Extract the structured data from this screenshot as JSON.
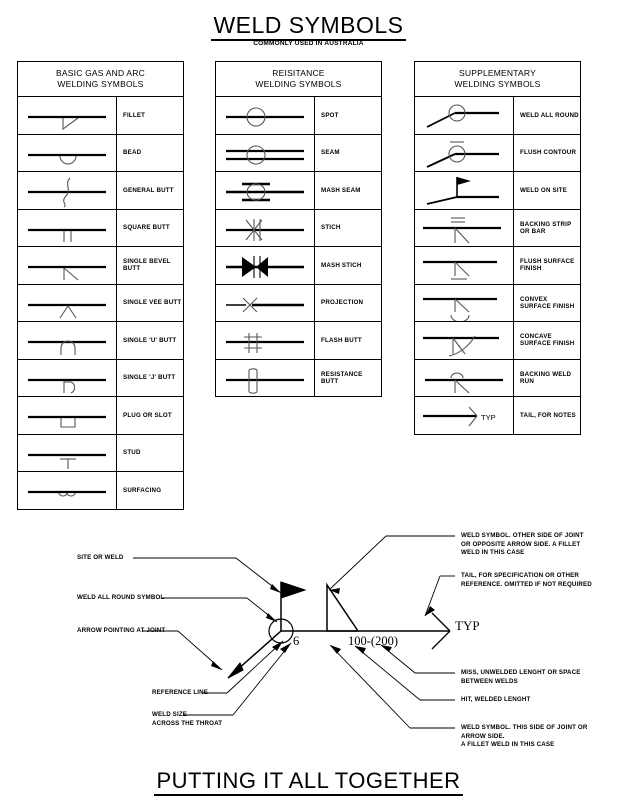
{
  "header": {
    "title": "WELD SYMBOLS",
    "subtitle": "COMMONLY USED IN AUSTRALIA"
  },
  "footer": {
    "title": "PUTTING IT ALL TOGETHER"
  },
  "tables": [
    {
      "id": "basic",
      "header_line1": "BASIC GAS AND ARC",
      "header_line2": "WELDING SYMBOLS",
      "rows": [
        {
          "symbol": "fillet-symbol",
          "label": "FILLET"
        },
        {
          "symbol": "bead-symbol",
          "label": "BEAD"
        },
        {
          "symbol": "general-butt-symbol",
          "label": "GENERAL BUTT"
        },
        {
          "symbol": "square-butt-symbol",
          "label": "SQUARE BUTT"
        },
        {
          "symbol": "single-bevel-butt-symbol",
          "label": "SINGLE BEVEL BUTT"
        },
        {
          "symbol": "single-vee-butt-symbol",
          "label": "SINGLE VEE BUTT"
        },
        {
          "symbol": "single-u-butt-symbol",
          "label": "SINGLE 'U' BUTT"
        },
        {
          "symbol": "single-j-butt-symbol",
          "label": "SINGLE 'J' BUTT"
        },
        {
          "symbol": "plug-or-slot-symbol",
          "label": "PLUG OR SLOT"
        },
        {
          "symbol": "stud-symbol",
          "label": "STUD"
        },
        {
          "symbol": "surfacing-symbol",
          "label": "SURFACING"
        }
      ]
    },
    {
      "id": "resistance",
      "header_line1": "REISITANCE",
      "header_line2": "WELDING SYMBOLS",
      "rows": [
        {
          "symbol": "spot-symbol",
          "label": "SPOT"
        },
        {
          "symbol": "seam-symbol",
          "label": "SEAM"
        },
        {
          "symbol": "mash-seam-symbol",
          "label": "MASH SEAM"
        },
        {
          "symbol": "stich-symbol",
          "label": "STICH"
        },
        {
          "symbol": "mash-stich-symbol",
          "label": "MASH STICH"
        },
        {
          "symbol": "projection-symbol",
          "label": "PROJECTION"
        },
        {
          "symbol": "flash-butt-symbol",
          "label": "FLASH BUTT"
        },
        {
          "symbol": "resistance-butt-symbol",
          "label": "RESISTANCE BUTT"
        }
      ]
    },
    {
      "id": "supplementary",
      "header_line1": "SUPPLEMENTARY",
      "header_line2": "WELDING SYMBOLS",
      "rows": [
        {
          "symbol": "weld-all-round-symbol",
          "label": "WELD ALL ROUND"
        },
        {
          "symbol": "flush-contour-symbol",
          "label": "FLUSH CONTOUR"
        },
        {
          "symbol": "weld-on-site-symbol",
          "label": "WELD ON SITE"
        },
        {
          "symbol": "backing-strip-symbol",
          "label": "BACKING STRIP OR BAR"
        },
        {
          "symbol": "flush-surface-finish-symbol",
          "label": "FLUSH SURFACE FINISH"
        },
        {
          "symbol": "convex-surface-finish-symbol",
          "label": "CONVEX SURFACE FINISH"
        },
        {
          "symbol": "concave-surface-finish-symbol",
          "label": "CONCAVE SURFACE FINISH"
        },
        {
          "symbol": "backing-weld-run-symbol",
          "label": "BACKING WELD RUN"
        },
        {
          "symbol": "tail-for-notes-symbol",
          "label": "TAIL, FOR NOTES",
          "symbol_text": "TYP"
        }
      ]
    }
  ],
  "diagram": {
    "weld_size": "6",
    "weld_length": "100-(200)",
    "tail_text": "TYP",
    "labels_left": [
      {
        "name": "site-or-weld-label",
        "text": "SITE OR WELD"
      },
      {
        "name": "weld-all-round-label",
        "text": "WELD ALL ROUND SYMBOL"
      },
      {
        "name": "arrow-pointing-at-joint-label",
        "text": "ARROW POINTING AT JOINT"
      },
      {
        "name": "reference-line-label",
        "text": "REFERENCE LINE"
      },
      {
        "name": "weld-size-label",
        "text": "WELD SIZE\nACROSS THE THROAT"
      }
    ],
    "labels_right": [
      {
        "name": "other-side-weld-symbol-label",
        "text": "WELD SYMBOL. OTHER SIDE OF JOINT\nOR OPPOSITE ARROW SIDE. A FILLET\nWELD IN THIS CASE"
      },
      {
        "name": "tail-specification-label",
        "text": "TAIL, FOR SPECIFICATION OR OTHER\nREFERENCE. OMITTED IF NOT REQUIRED"
      },
      {
        "name": "miss-unwelded-length-label",
        "text": "MISS, UNWELDED LENGHT OR SPACE\nBETWEEN WELDS"
      },
      {
        "name": "hit-welded-length-label",
        "text": "HIT, WELDED LENGHT"
      },
      {
        "name": "this-side-weld-symbol-label",
        "text": "WELD SYMBOL. THIS SIDE OF JOINT OR\nARROW SIDE.\nA FILLET WELD IN THIS CASE"
      }
    ]
  }
}
